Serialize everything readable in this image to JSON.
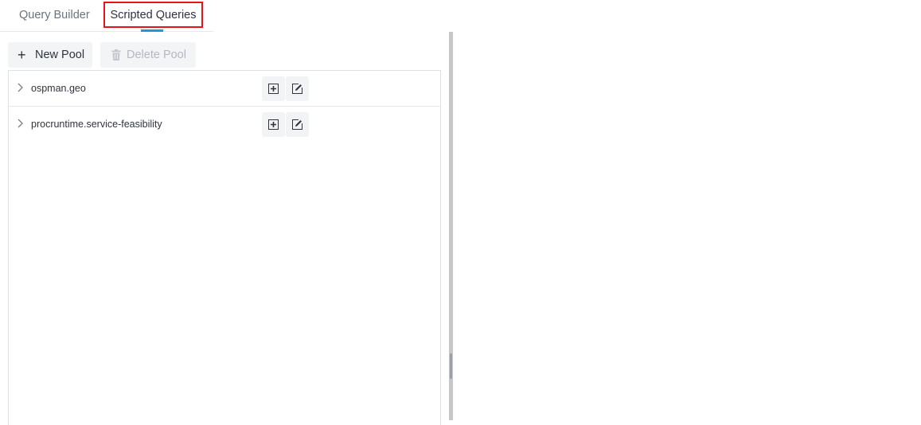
{
  "tabs": [
    {
      "label": "Query Builder",
      "active": false
    },
    {
      "label": "Scripted Queries",
      "active": true,
      "highlighted": true
    }
  ],
  "toolbar": {
    "new_pool_label": "New Pool",
    "new_pool_icon": "plus-icon",
    "delete_pool_label": "Delete Pool",
    "delete_pool_icon": "trash-icon",
    "delete_pool_disabled": true
  },
  "pools": [
    {
      "name": "ospman.geo",
      "expanded": false,
      "actions": [
        "add-query-icon",
        "edit-icon"
      ]
    },
    {
      "name": "procruntime.service-feasibility",
      "expanded": false,
      "actions": [
        "add-query-icon",
        "edit-icon"
      ]
    }
  ],
  "colors": {
    "active_tab_indicator": "#1a9ad6",
    "highlight_box": "#e8121a",
    "button_bg": "#f3f4f6",
    "disabled_text": "#b4b8c0"
  }
}
